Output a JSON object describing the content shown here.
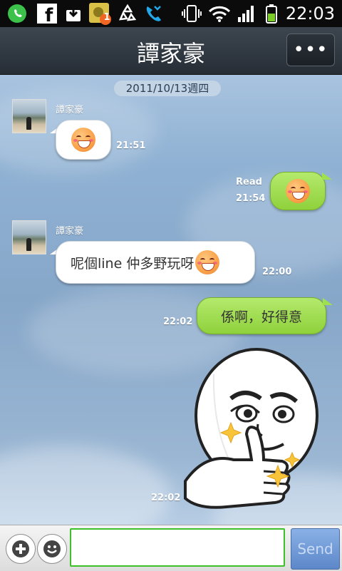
{
  "status_bar": {
    "time": "22:03",
    "notification_badge": "1",
    "icons": [
      "whatsapp-icon",
      "facebook-icon",
      "download-icon",
      "photo-notification-icon",
      "recycle-icon",
      "phone-call-icon",
      "vibrate-icon",
      "wifi-icon",
      "signal-icon",
      "battery-icon"
    ]
  },
  "header": {
    "title": "譚家豪",
    "menu_label": "•••"
  },
  "chat": {
    "date_label": "2011/10/13週四",
    "messages": [
      {
        "sender": "譚家豪",
        "text": "",
        "time": "21:51"
      },
      {
        "read_label": "Read",
        "text": "",
        "time": "21:54"
      },
      {
        "sender": "譚家豪",
        "text": "呢個line 仲多野玩呀",
        "time": "22:00"
      },
      {
        "text": "係啊，好得意",
        "time": "22:02"
      },
      {
        "time": "22:02"
      }
    ]
  },
  "input_bar": {
    "placeholder": "",
    "send_label": "Send"
  },
  "colors": {
    "outgoing_bubble": "#9ee04f",
    "input_border": "#3ec02b",
    "send_button": "#6d96d6"
  }
}
